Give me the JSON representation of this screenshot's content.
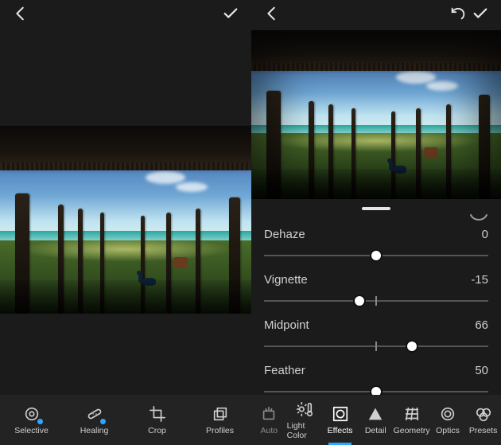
{
  "topbar": {
    "back_icon": "chevron-left",
    "confirm_icon": "checkmark",
    "undo_icon": "undo"
  },
  "sliders": [
    {
      "label": "Dehaze",
      "value": "0",
      "thumb_pct": 50,
      "tick_pct": 50
    },
    {
      "label": "Vignette",
      "value": "-15",
      "thumb_pct": 42.5,
      "tick_pct": 50
    },
    {
      "label": "Midpoint",
      "value": "66",
      "thumb_pct": 66,
      "tick_pct": 50
    },
    {
      "label": "Feather",
      "value": "50",
      "thumb_pct": 50,
      "tick_pct": null
    }
  ],
  "toolbar_left": [
    {
      "id": "selective",
      "label": "Selective",
      "icon": "target",
      "badge": true
    },
    {
      "id": "healing",
      "label": "Healing",
      "icon": "bandaid",
      "badge": true
    },
    {
      "id": "crop",
      "label": "Crop",
      "icon": "crop",
      "badge": false
    },
    {
      "id": "profiles",
      "label": "Profiles",
      "icon": "stacksquare",
      "badge": false
    }
  ],
  "toolbar_right": [
    {
      "id": "auto",
      "label": "Auto",
      "icon": "magic",
      "dim": true
    },
    {
      "id": "light",
      "label": "Light Color",
      "icon": "sun-therm",
      "dim": false
    },
    {
      "id": "effects",
      "label": "Effects",
      "icon": "vignette-sq",
      "dim": false,
      "active": true
    },
    {
      "id": "detail",
      "label": "Detail",
      "icon": "triangle",
      "dim": false
    },
    {
      "id": "geometry",
      "label": "Geometry",
      "icon": "grid3d",
      "dim": false
    },
    {
      "id": "optics",
      "label": "Optics",
      "icon": "lens",
      "dim": false
    },
    {
      "id": "presets",
      "label": "Presets",
      "icon": "presets",
      "dim": false
    }
  ]
}
